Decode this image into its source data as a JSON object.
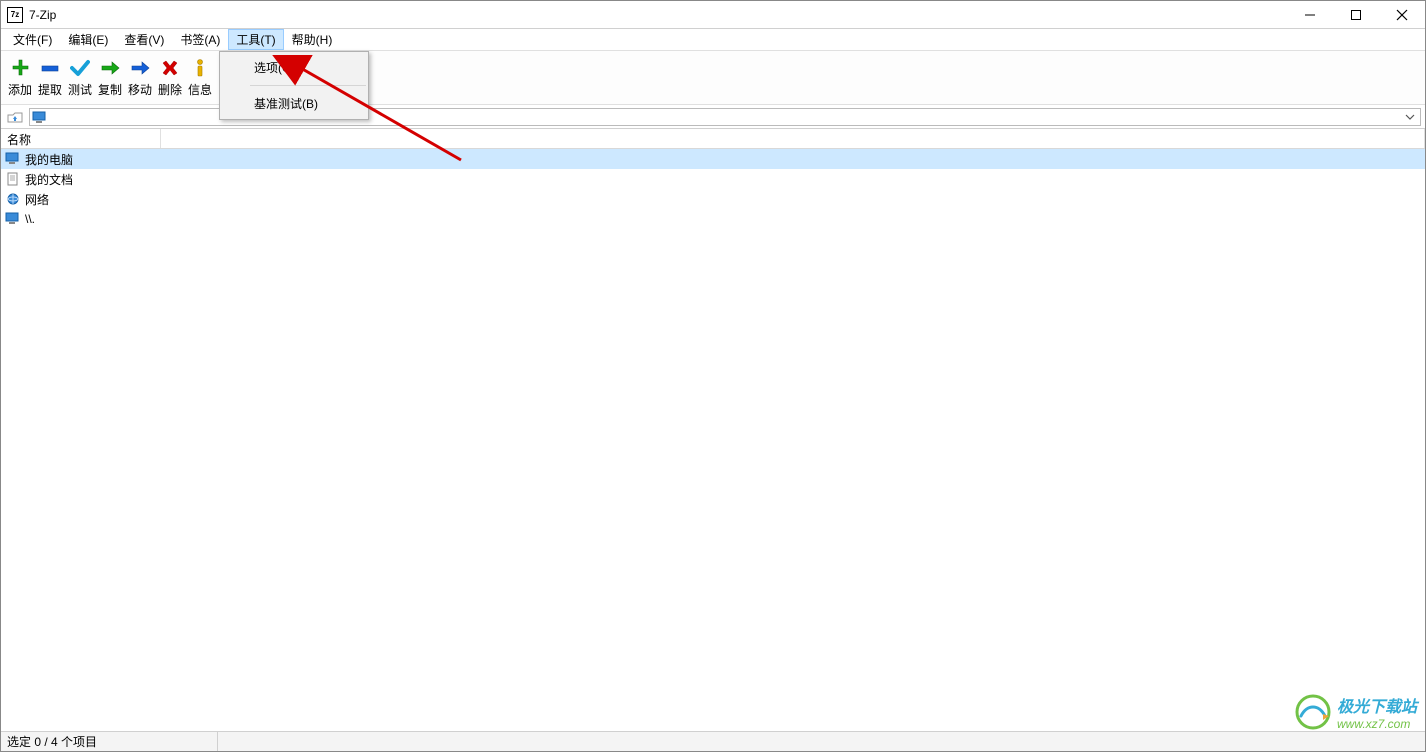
{
  "titlebar": {
    "app_icon_text": "7z",
    "title": "7-Zip"
  },
  "menubar": {
    "items": [
      {
        "label": "文件(F)"
      },
      {
        "label": "编辑(E)"
      },
      {
        "label": "查看(V)"
      },
      {
        "label": "书签(A)"
      },
      {
        "label": "工具(T)",
        "active": true
      },
      {
        "label": "帮助(H)"
      }
    ]
  },
  "dropdown": {
    "items": [
      {
        "label": "选项(O)"
      },
      {
        "label": "基准测试(B)"
      }
    ]
  },
  "toolbar": {
    "buttons": [
      {
        "label": "添加",
        "icon": "plus"
      },
      {
        "label": "提取",
        "icon": "minus"
      },
      {
        "label": "测试",
        "icon": "check"
      },
      {
        "label": "复制",
        "icon": "copy-arrow"
      },
      {
        "label": "移动",
        "icon": "move-arrow"
      },
      {
        "label": "删除",
        "icon": "delete-x"
      },
      {
        "label": "信息",
        "icon": "info-i"
      }
    ]
  },
  "list": {
    "header_name": "名称",
    "rows": [
      {
        "label": "我的电脑",
        "icon": "computer",
        "selected": true
      },
      {
        "label": "我的文档",
        "icon": "document",
        "selected": false
      },
      {
        "label": "网络",
        "icon": "network",
        "selected": false
      },
      {
        "label": "\\\\.",
        "icon": "computer",
        "selected": false
      }
    ]
  },
  "statusbar": {
    "text": "选定 0 / 4 个项目"
  },
  "watermark": {
    "line1": "极光下载站",
    "line2": "www.xz7.com"
  },
  "colors": {
    "selection": "#cde8ff",
    "arrow": "#d40000",
    "icon_green": "#17a817",
    "icon_blue": "#1560d8",
    "icon_red": "#d40000",
    "icon_yellow": "#e8b200"
  }
}
